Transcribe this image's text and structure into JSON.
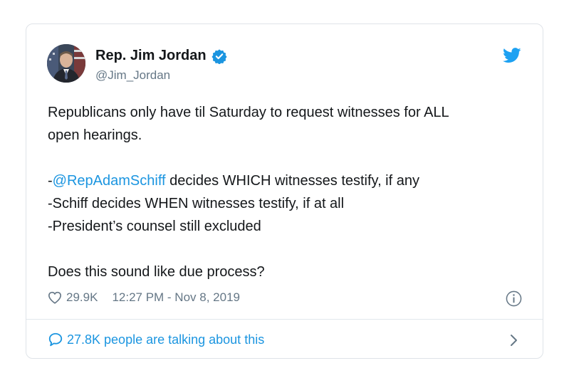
{
  "author": {
    "name": "Rep. Jim Jordan",
    "handle": "@Jim_Jordan",
    "verified": true
  },
  "tweet": {
    "line1": "Republicans only have til Saturday to request witnesses for ALL",
    "line2": "open hearings.",
    "line3_prefix": "-",
    "line3_mention": "@RepAdamSchiff",
    "line3_rest": " decides WHICH witnesses testify, if any",
    "line4": "-Schiff decides WHEN witnesses testify, if at all",
    "line5": "-President’s counsel still excluded",
    "line6": "Does this sound like due process?"
  },
  "meta": {
    "likes": "29.9K",
    "timestamp": "12:27 PM - Nov 8, 2019"
  },
  "footer": {
    "talking": "27.8K people are talking about this"
  },
  "icons": {
    "brand": "twitter-bird-icon",
    "verified": "verified-badge-icon",
    "like": "heart-icon",
    "info": "info-icon",
    "reply": "speech-bubble-icon",
    "more": "chevron-right-icon"
  },
  "colors": {
    "link": "#1b95e0",
    "secondary_text": "#657786",
    "border": "#dfe3e8"
  }
}
